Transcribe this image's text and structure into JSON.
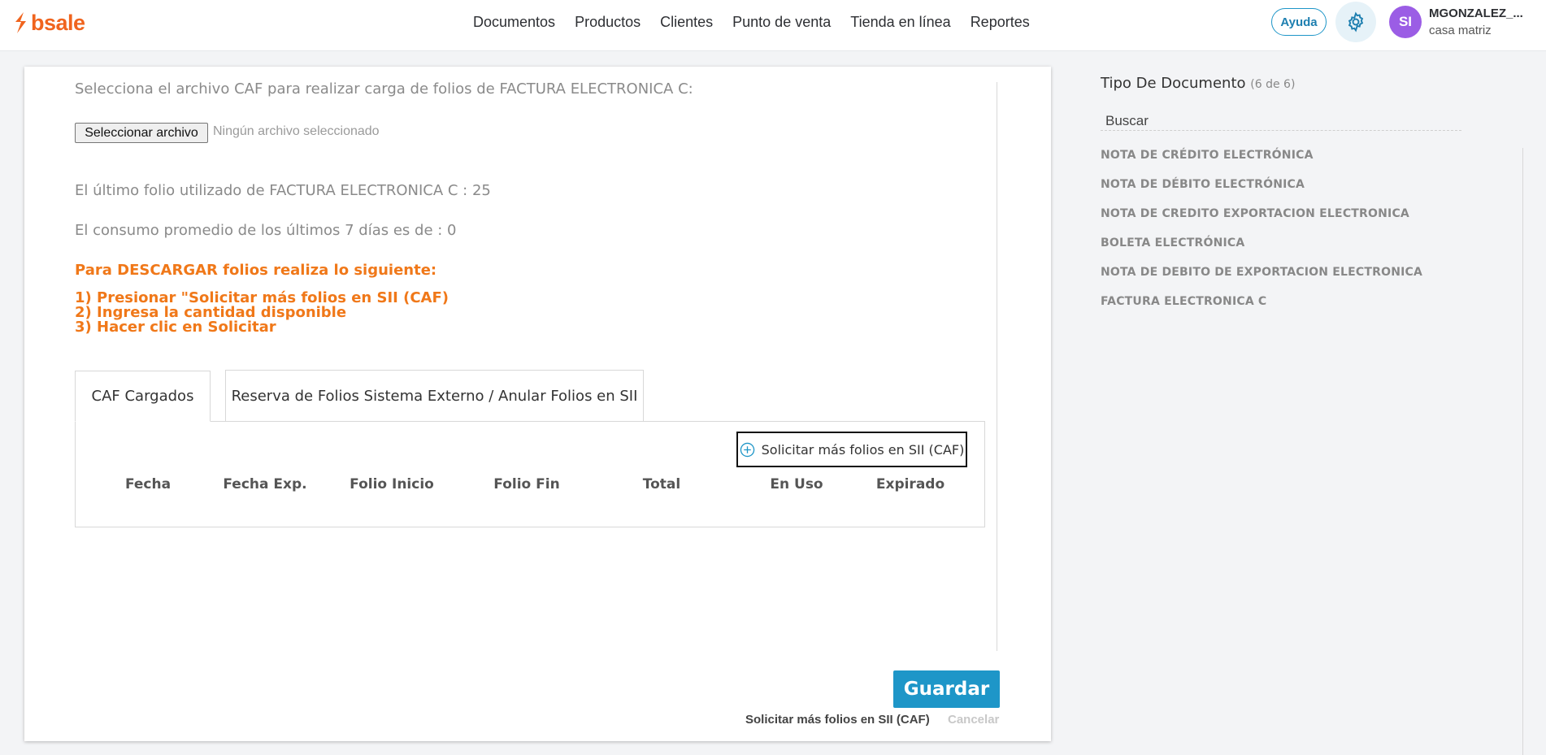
{
  "brand": {
    "name": "bsale",
    "color": "#f0641e"
  },
  "nav": {
    "items": [
      "Documentos",
      "Productos",
      "Clientes",
      "Punto de venta",
      "Tienda en línea",
      "Reportes"
    ]
  },
  "header": {
    "help_label": "Ayuda",
    "settings_icon": "gear-icon",
    "avatar_initials": "SI",
    "user_name": "MGONZALEZ_...",
    "branch": "casa matriz"
  },
  "upload": {
    "instruction": "Selecciona el archivo CAF para realizar carga de folios de FACTURA ELECTRONICA C:",
    "choose_file_label": "Seleccionar archivo",
    "no_file_label": "Ningún archivo seleccionado"
  },
  "info": {
    "last_folio": "El último folio utilizado de FACTURA ELECTRONICA C : 25",
    "avg_consumption": "El consumo promedio de los últimos 7 días es de : 0"
  },
  "download_instructions": {
    "heading": "Para DESCARGAR folios realiza lo siguiente:",
    "steps": [
      "1) Presionar \"Solicitar más folios en SII (CAF)",
      "2) Ingresa la cantidad disponible",
      "3) Hacer clic en Solicitar"
    ]
  },
  "tabs": [
    {
      "label": "CAF Cargados",
      "active": true
    },
    {
      "label": "Reserva de Folios Sistema Externo / Anular Folios en SII",
      "active": false
    }
  ],
  "caf_table": {
    "request_button_label": "Solicitar más folios en SII (CAF)",
    "columns": [
      "Fecha",
      "Fecha Exp.",
      "Folio Inicio",
      "Folio Fin",
      "Total",
      "En Uso",
      "Expirado"
    ],
    "rows": []
  },
  "footer": {
    "save_label": "Guardar",
    "request_link": "Solicitar más folios en SII (CAF)",
    "cancel_link": "Cancelar"
  },
  "sidebar": {
    "title": "Tipo De Documento",
    "count": "(6 de 6)",
    "search_placeholder": "Buscar",
    "items": [
      "NOTA DE CRÉDITO ELECTRÓNICA",
      "NOTA DE DÉBITO ELECTRÓNICA",
      "NOTA DE CREDITO EXPORTACION ELECTRONICA",
      "BOLETA ELECTRÓNICA",
      "NOTA DE DEBITO DE EXPORTACION ELECTRONICA",
      "FACTURA ELECTRONICA C"
    ]
  },
  "colors": {
    "accent": "#1e96c8",
    "orange_text": "#f07819",
    "avatar": "#9b5de5"
  }
}
